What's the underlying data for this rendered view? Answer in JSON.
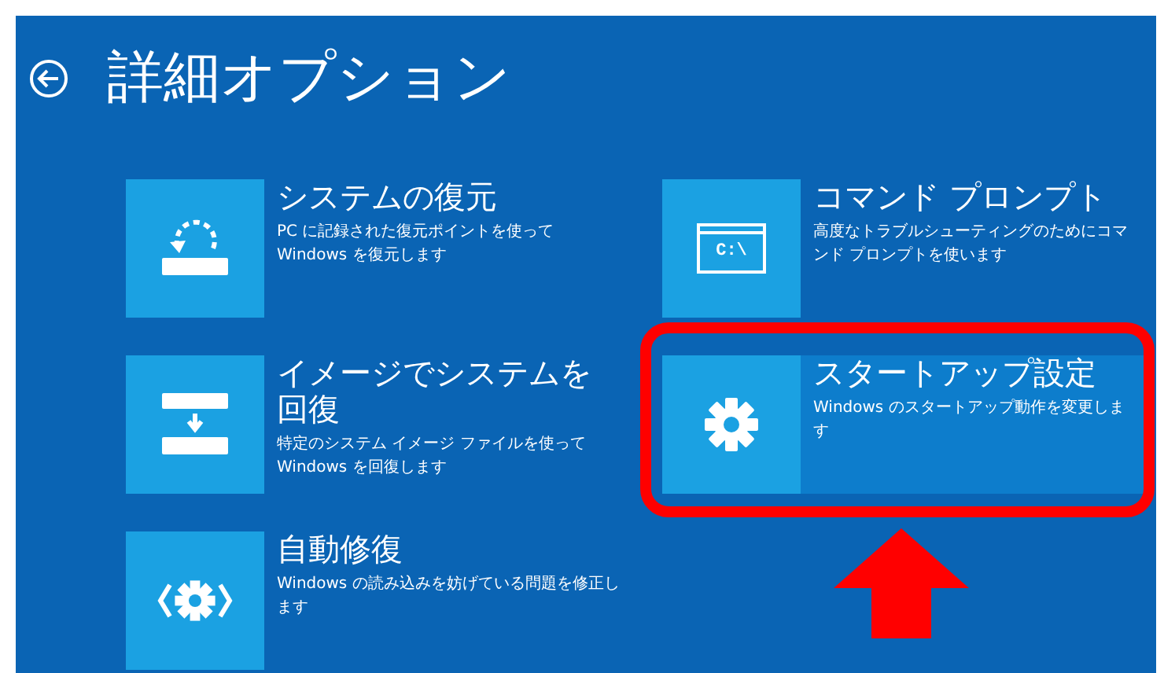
{
  "header": {
    "title": "詳細オプション"
  },
  "options": [
    {
      "kind": "restore",
      "title": "システムの復元",
      "description": "PC に記録された復元ポイントを使って Windows を復元します",
      "selected": false
    },
    {
      "kind": "cmd",
      "title": "コマンド プロンプト",
      "description": "高度なトラブルシューティングのためにコマンド プロンプトを使います",
      "icon_text": "C:\\",
      "selected": false
    },
    {
      "kind": "image",
      "title": "イメージでシステムを回復",
      "description": "特定のシステム イメージ ファイルを使って Windows を回復します",
      "selected": false
    },
    {
      "kind": "gear",
      "title": "スタートアップ設定",
      "description": "Windows のスタートアップ動作を変更します",
      "selected": true
    },
    {
      "kind": "repair",
      "title": "自動修復",
      "description": "Windows の読み込みを妨げている問題を修正します",
      "selected": false
    }
  ]
}
